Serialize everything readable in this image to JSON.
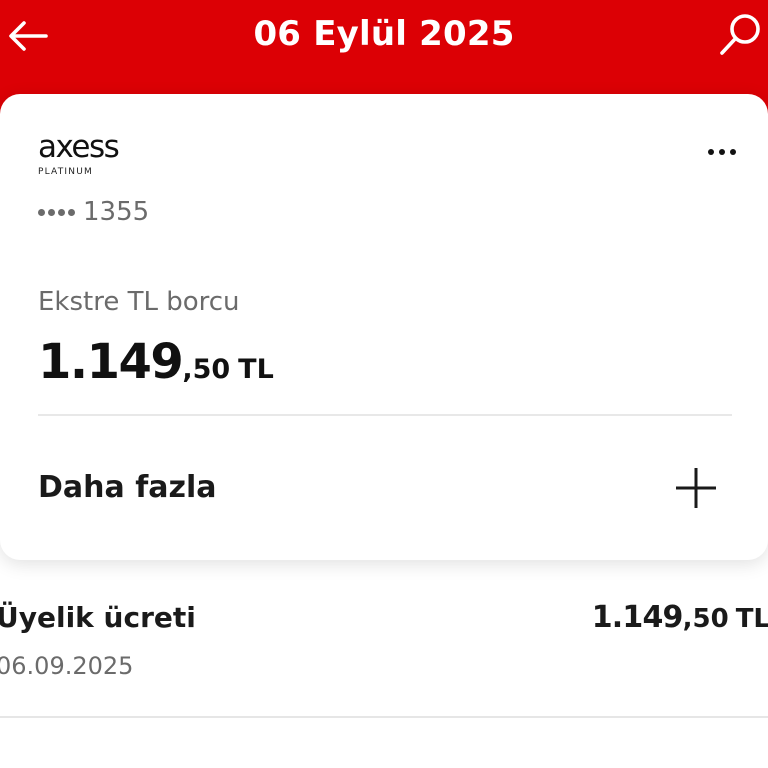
{
  "header": {
    "title": "06 Eylül 2025",
    "back_icon": "arrow-left-icon",
    "search_icon": "search-icon",
    "background_color": "#dc0005"
  },
  "card": {
    "brand": "axess",
    "tier": "PLATINUM",
    "card_number_last4": "1355",
    "more_icon": "more-horizontal-icon",
    "debt_label": "Ekstre TL borcu",
    "debt_integer": "1.149",
    "debt_decimal": ",50",
    "debt_currency": "TL",
    "more_label": "Daha fazla",
    "expand_icon": "plus-icon"
  },
  "transactions": [
    {
      "title": "Üyelik ücreti",
      "date": "06.09.2025",
      "amount_integer": "1.149",
      "amount_decimal": ",50",
      "amount_currency": "TL"
    }
  ]
}
